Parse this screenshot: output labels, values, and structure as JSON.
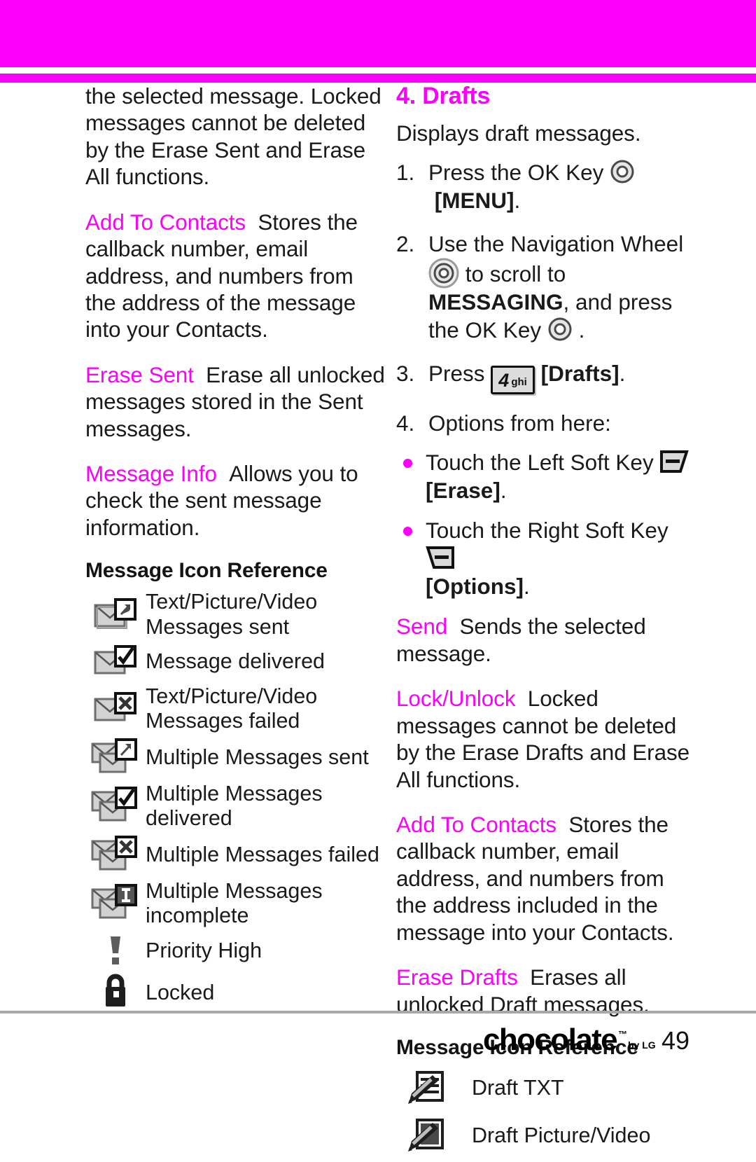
{
  "colors": {
    "accent": "#fb00fb",
    "text": "#1a1a1a",
    "rule": "#a8a8a8"
  },
  "left_column": {
    "continued_paragraph": "the selected message. Locked messages cannot be deleted by the Erase Sent and Erase All functions.",
    "terms": [
      {
        "term": "Add To Contacts",
        "desc": "Stores the callback number, email address, and numbers from the address of the message into your Contacts."
      },
      {
        "term": "Erase Sent",
        "desc": "Erase all unlocked messages stored in the Sent messages."
      },
      {
        "term": "Message Info",
        "desc": "Allows you to check the sent message information."
      }
    ],
    "icon_reference": {
      "heading": "Message Icon Reference",
      "rows": [
        {
          "icon": "envelope-arrow-icon",
          "label": "Text/Picture/Video Messages sent"
        },
        {
          "icon": "envelope-check-icon",
          "label": "Message delivered"
        },
        {
          "icon": "envelope-x-icon",
          "label": "Text/Picture/Video Messages failed"
        },
        {
          "icon": "multi-envelope-arrow-icon",
          "label": "Multiple Messages sent"
        },
        {
          "icon": "multi-envelope-check-icon",
          "label": "Multiple Messages delivered"
        },
        {
          "icon": "multi-envelope-x-icon",
          "label": "Multiple Messages failed"
        },
        {
          "icon": "multi-envelope-incomplete-icon",
          "label": "Multiple Messages incomplete"
        },
        {
          "icon": "priority-high-icon",
          "label": "Priority High"
        },
        {
          "icon": "padlock-icon",
          "label": "Locked"
        }
      ]
    }
  },
  "right_column": {
    "section_title": "4. Drafts",
    "intro": "Displays draft messages.",
    "steps": [
      {
        "num": "1.",
        "pre": "Press the OK Key ",
        "icon": "ok-key-icon",
        "post": " [MENU]."
      },
      {
        "num": "2.",
        "pre": "Use the Navigation Wheel ",
        "icon": "navigation-wheel-icon",
        "post": " to scroll to MESSAGING, and press the OK Key ",
        "icon2": "ok-key-icon",
        "post2": " ."
      },
      {
        "num": "3.",
        "pre": "Press ",
        "icon": "key-4-ghi-icon",
        "post": " [Drafts]."
      },
      {
        "num": "4.",
        "pre": "Options from here:",
        "icon": "",
        "post": ""
      }
    ],
    "step_keycap": {
      "digit": "4",
      "letters": "ghi"
    },
    "step_bold": {
      "messaging": "MESSAGING",
      "menu": "[MENU]",
      "drafts": "[Drafts]"
    },
    "bullets": [
      {
        "pre": "Touch the Left Soft Key ",
        "icon": "left-soft-key-icon",
        "post": "",
        "bold": "[Erase]",
        "tail": "."
      },
      {
        "pre": "Touch the Right Soft Key ",
        "icon": "right-soft-key-icon",
        "post": "",
        "bold": "[Options]",
        "tail": "."
      }
    ],
    "terms": [
      {
        "term": "Send",
        "desc": "Sends the selected message."
      },
      {
        "term": "Lock/Unlock",
        "desc": "Locked messages cannot be deleted by the Erase Drafts and Erase All functions."
      },
      {
        "term": "Add To Contacts",
        "desc": "Stores the callback number, email address, and numbers from the address included in the message into your Contacts."
      },
      {
        "term": "Erase Drafts",
        "desc": "Erases all unlocked Draft messages."
      }
    ],
    "icon_reference": {
      "heading": "Message Icon Reference",
      "rows": [
        {
          "icon": "draft-text-icon",
          "label": "Draft TXT"
        },
        {
          "icon": "draft-picture-icon",
          "label": "Draft Picture/Video"
        }
      ]
    }
  },
  "footer": {
    "brand": "chocolate",
    "brand_tm": "™",
    "brand_by": "by LG",
    "page_number": "49"
  }
}
